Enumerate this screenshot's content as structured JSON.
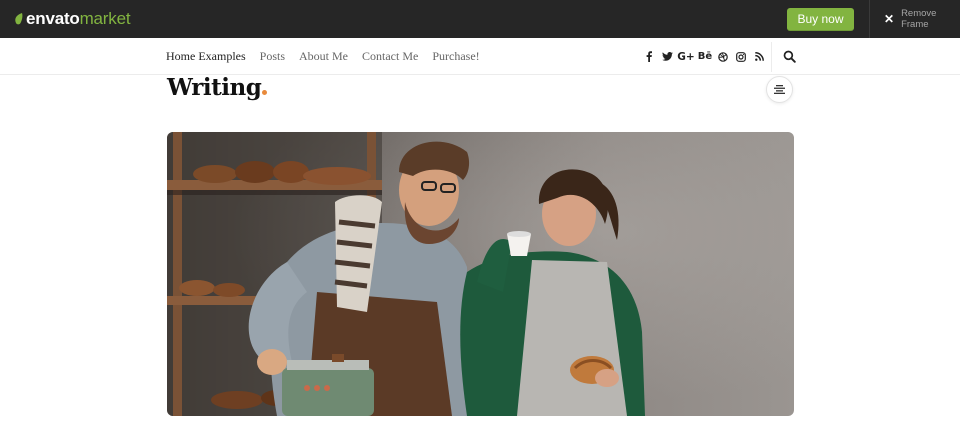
{
  "envato": {
    "logo_bold": "envato",
    "logo_light": "market",
    "buy_label": "Buy now",
    "remove_frame_label": "Remove Frame",
    "brand_color": "#82b440"
  },
  "nav": {
    "items": [
      {
        "label": "Home Examples"
      },
      {
        "label": "Posts"
      },
      {
        "label": "About Me"
      },
      {
        "label": "Contact Me"
      },
      {
        "label": "Purchase!"
      }
    ]
  },
  "socials": [
    {
      "icon": "facebook-icon",
      "glyph": "f"
    },
    {
      "icon": "twitter-icon",
      "glyph": "🐦"
    },
    {
      "icon": "google-plus-icon",
      "glyph": "G+"
    },
    {
      "icon": "behance-icon",
      "glyph": "Bē"
    },
    {
      "icon": "dribbble-icon",
      "glyph": "◎"
    },
    {
      "icon": "instagram-icon",
      "glyph": "◻"
    },
    {
      "icon": "rss-icon",
      "glyph": "◜"
    }
  ],
  "page": {
    "title": "Writing",
    "accent_color": "#e88a3c"
  },
  "hero": {
    "icon": "photo-bakery-couple"
  }
}
